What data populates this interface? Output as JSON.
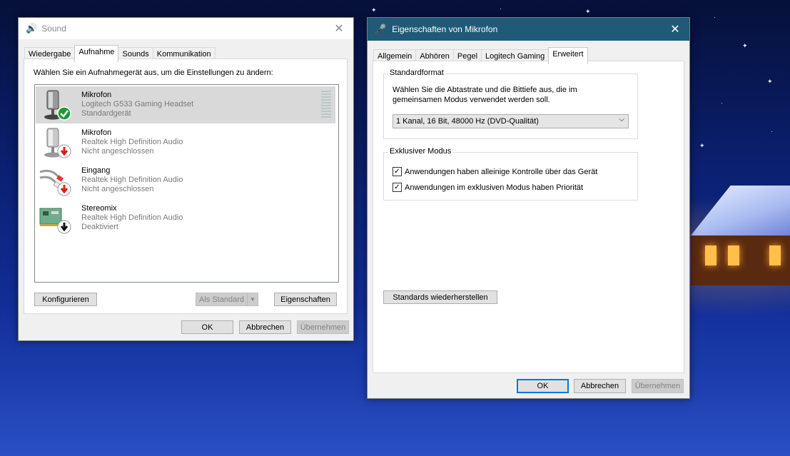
{
  "sound_dialog": {
    "title": "Sound",
    "tabs": [
      "Wiedergabe",
      "Aufnahme",
      "Sounds",
      "Kommunikation"
    ],
    "instruction": "Wählen Sie ein Aufnahmegerät aus, um die Einstellungen zu ändern:",
    "devices": [
      {
        "name": "Mikrofon",
        "line1": "Logitech G533 Gaming Headset",
        "line2": "Standardgerät"
      },
      {
        "name": "Mikrofon",
        "line1": "Realtek High Definition Audio",
        "line2": "Nicht angeschlossen"
      },
      {
        "name": "Eingang",
        "line1": "Realtek High Definition Audio",
        "line2": "Nicht angeschlossen"
      },
      {
        "name": "Stereomix",
        "line1": "Realtek High Definition Audio",
        "line2": "Deaktiviert"
      }
    ],
    "btn_configure": "Konfigurieren",
    "btn_default": "Als Standard",
    "btn_properties": "Eigenschaften",
    "btn_ok": "OK",
    "btn_cancel": "Abbrechen",
    "btn_apply": "Übernehmen"
  },
  "props_dialog": {
    "title": "Eigenschaften von Mikrofon",
    "tabs": [
      "Allgemein",
      "Abhören",
      "Pegel",
      "Logitech Gaming",
      "Erweitert"
    ],
    "group_format": "Standardformat",
    "format_desc_1": "Wählen Sie die Abtastrate und die Bittiefe aus, die im",
    "format_desc_2": "gemeinsamen Modus verwendet werden soll.",
    "format_value": "1 Kanal, 16 Bit, 48000 Hz (DVD-Qualität)",
    "group_exclusive": "Exklusiver Modus",
    "chk1": "Anwendungen haben alleinige Kontrolle über das Gerät",
    "chk2": "Anwendungen im exklusiven Modus haben Priorität",
    "btn_restore": "Standards wiederherstellen",
    "btn_ok": "OK",
    "btn_cancel": "Abbrechen",
    "btn_apply": "Übernehmen"
  },
  "colors": {
    "accent": "#0078d7",
    "props_titlebar": "#1f5a78",
    "ok_check": "#1a9a34",
    "disconnected_arrow": "#e0191e"
  }
}
